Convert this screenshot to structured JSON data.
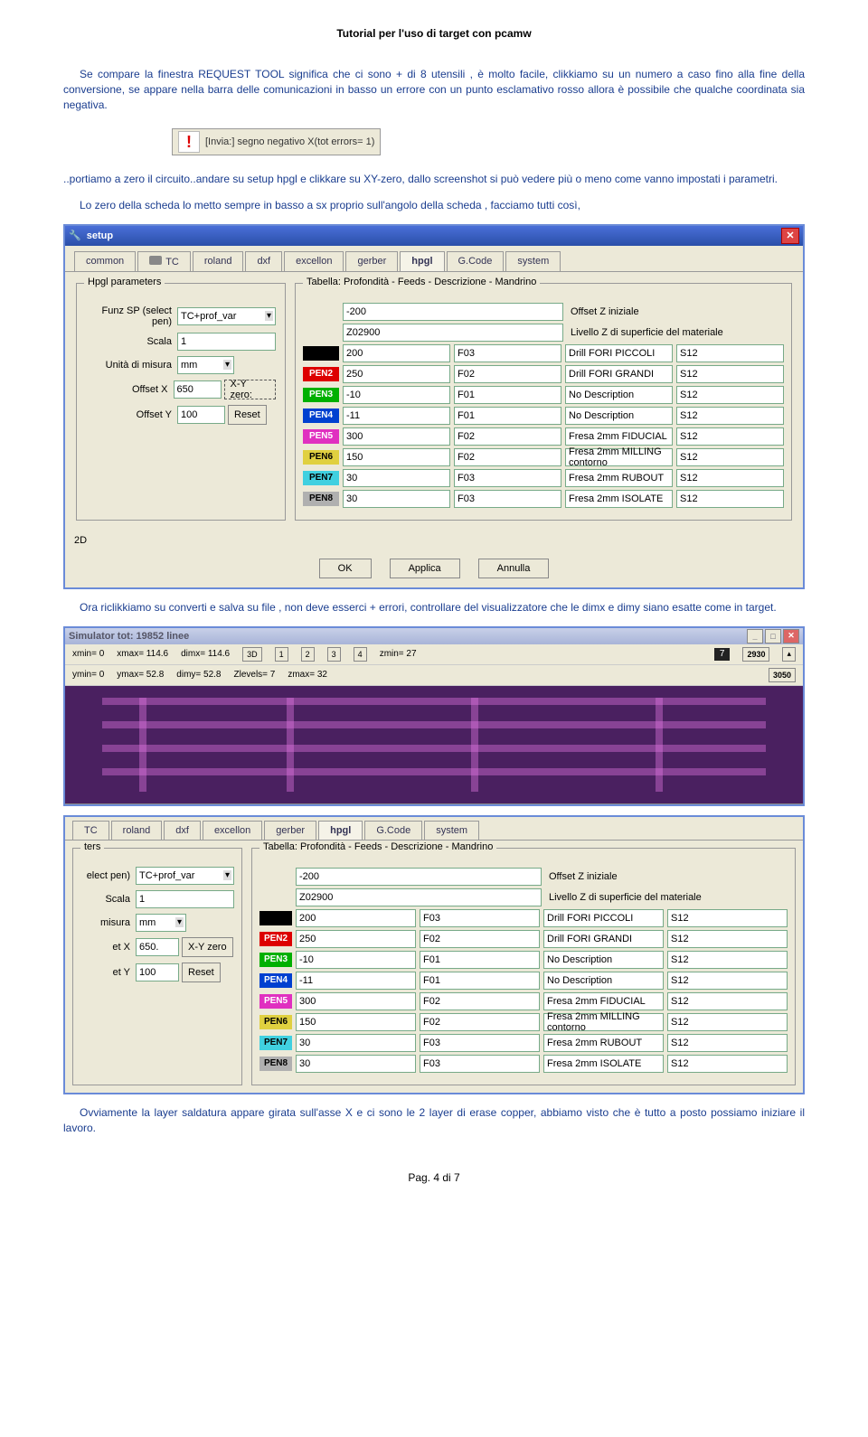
{
  "page_title": "Tutorial per l'uso di target con pcamw",
  "p1": "Se compare la finestra REQUEST TOOL significa che ci sono + di 8 utensili , è molto facile, clikkiamo su un numero a caso fino alla fine della conversione, se appare nella barra delle comunicazioni in basso un errore con un punto esclamativo rosso allora è possibile che qualche coordinata sia negativa.",
  "warn": "[Invia:] segno negativo X(tot errors= 1)",
  "p2": "..portiamo a zero il circuito..andare su setup hpgl e clikkare su XY-zero, dallo screenshot si può vedere più o meno come vanno impostati i parametri.",
  "p3": "Lo zero della scheda lo metto sempre in basso a sx proprio sull'angolo della scheda , facciamo tutti così,",
  "win1": {
    "title": "setup",
    "tabs": [
      "common",
      "TC",
      "roland",
      "dxf",
      "excellon",
      "gerber",
      "hpgl",
      "G.Code",
      "system"
    ],
    "left_legend": "Hpgl parameters",
    "funz_label": "Funz SP (select pen)",
    "funz": "TC+prof_var",
    "scala_label": "Scala",
    "scala": "1",
    "unit_label": "Unità di misura",
    "unit": "mm",
    "ox_label": "Offset X",
    "ox": "650",
    "xy": "X-Y zero:",
    "oy_label": "Offset Y",
    "oy": "100",
    "reset": "Reset",
    "two_d": "2D",
    "r_legend": "Tabella: Profondità - Feeds - Descrizione - Mandrino",
    "h1": {
      "v": "-200",
      "t": "Offset Z iniziale"
    },
    "h2": {
      "v": "Z02900",
      "t": "Livello Z di superficie del materiale"
    },
    "rows": [
      {
        "pen": "",
        "cls": "c-black",
        "a": "200",
        "b": "F03",
        "c": "Drill FORI PICCOLI",
        "d": "S12"
      },
      {
        "pen": "PEN2",
        "cls": "c-red",
        "a": "250",
        "b": "F02",
        "c": "Drill FORI GRANDI",
        "d": "S12"
      },
      {
        "pen": "PEN3",
        "cls": "c-green",
        "a": "-10",
        "b": "F01",
        "c": "No Description",
        "d": "S12"
      },
      {
        "pen": "PEN4",
        "cls": "c-blue",
        "a": "-11",
        "b": "F01",
        "c": "No Description",
        "d": "S12"
      },
      {
        "pen": "PEN5",
        "cls": "c-mag",
        "a": "300",
        "b": "F02",
        "c": "Fresa 2mm FIDUCIAL",
        "d": "S12"
      },
      {
        "pen": "PEN6",
        "cls": "c-yel",
        "a": "150",
        "b": "F02",
        "c": "Fresa 2mm MILLING contorno",
        "d": "S12"
      },
      {
        "pen": "PEN7",
        "cls": "c-cyan",
        "a": "30",
        "b": "F03",
        "c": "Fresa 2mm RUBOUT",
        "d": "S12"
      },
      {
        "pen": "PEN8",
        "cls": "c-gray",
        "a": "30",
        "b": "F03",
        "c": "Fresa 2mm ISOLATE",
        "d": "S12"
      }
    ],
    "ok": "OK",
    "apply": "Applica",
    "cancel": "Annulla"
  },
  "p4": "Ora riclikkiamo su converti e salva su  file , non deve esserci + errori, controllare del visualizzatore che le dimx e dimy siano esatte come in target.",
  "sim": {
    "title": "Simulator   tot: 19852 linee",
    "r1": {
      "a": "xmin= 0",
      "b": "xmax= 114.6",
      "c": "dimx= 114.6",
      "d": "3D",
      "e": "zmin= 27",
      "n1": "7",
      "n2": "2930"
    },
    "r2": {
      "a": "ymin= 0",
      "b": "ymax= 52.8",
      "c": "dimy= 52.8",
      "d": "Zlevels= 7",
      "e": "zmax= 32",
      "n2": "3050"
    }
  },
  "win2": {
    "tabs": [
      "TC",
      "roland",
      "dxf",
      "excellon",
      "gerber",
      "hpgl",
      "G.Code",
      "system"
    ],
    "left_legend": "ters",
    "funz_label": "elect pen)",
    "funz": "TC+prof_var",
    "scala_label": "Scala",
    "scala": "1",
    "unit_label": "misura",
    "unit": "mm",
    "ox_label": "et X",
    "ox": "650.",
    "xy": "X-Y zero",
    "oy_label": "et Y",
    "oy": "100",
    "reset": "Reset",
    "r_legend": "Tabella: Profondità - Feeds - Descrizione - Mandrino",
    "h1": {
      "v": "-200",
      "t": "Offset Z iniziale"
    },
    "h2": {
      "v": "Z02900",
      "t": "Livello Z di superficie del materiale"
    }
  },
  "p5": "Ovviamente la layer saldatura appare girata sull'asse X e ci sono le 2 layer di erase copper, abbiamo visto che è tutto a posto possiamo iniziare il lavoro.",
  "footer": "Pag. 4 di 7"
}
